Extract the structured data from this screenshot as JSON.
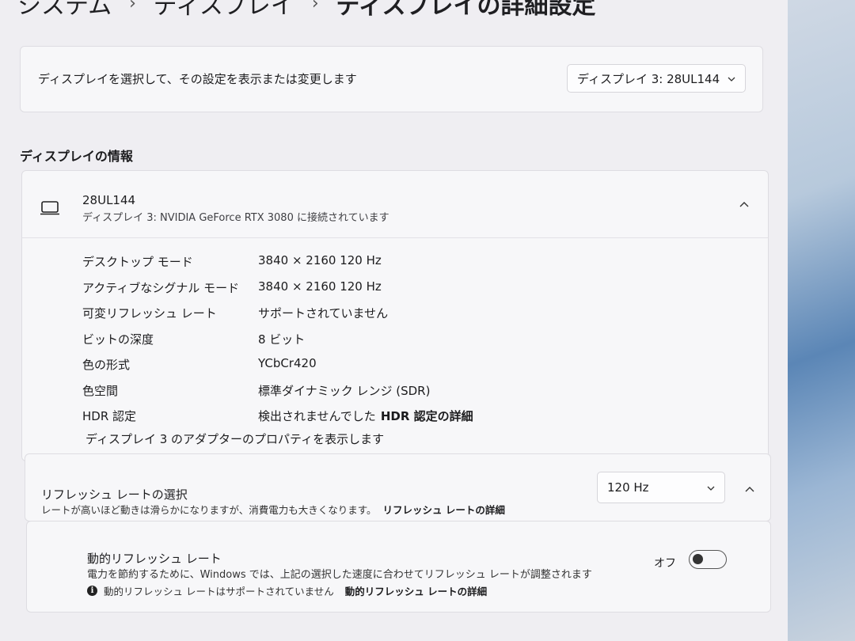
{
  "breadcrumb": {
    "items": [
      "システム",
      "ディスプレイ"
    ],
    "current": "ディスプレイの詳細設定",
    "separator": "›"
  },
  "selector": {
    "label": "ディスプレイを選択して、その設定を表示または変更します",
    "value": "ディスプレイ 3: 28UL144"
  },
  "section_title": "ディスプレイの情報",
  "monitor": {
    "name": "28UL144",
    "subtitle": "ディスプレイ 3: NVIDIA GeForce RTX 3080 に接続されています",
    "rows": [
      {
        "key": "デスクトップ モード",
        "value": "3840 × 2160 120 Hz"
      },
      {
        "key": "アクティブなシグナル モード",
        "value": "3840 × 2160 120 Hz"
      },
      {
        "key": "可変リフレッシュ レート",
        "value": "サポートされていません"
      },
      {
        "key": "ビットの深度",
        "value": "8 ビット"
      },
      {
        "key": "色の形式",
        "value": "YCbCr420"
      },
      {
        "key": "色空間",
        "value": "標準ダイナミック レンジ (SDR)"
      },
      {
        "key": "HDR 認定",
        "value": "検出されませんでした",
        "link": "HDR 認定の詳細"
      }
    ],
    "adapter_link": "ディスプレイ 3 のアダプターのプロパティを表示します"
  },
  "refresh": {
    "title": "リフレッシュ レートの選択",
    "description": "レートが高いほど動きは滑らかになりますが、消費電力も大きくなります。",
    "link": "リフレッシュ レートの詳細",
    "value": "120 Hz"
  },
  "dynamic_refresh": {
    "title": "動的リフレッシュ レート",
    "description": "電力を節約するために、Windows では、上記の選択した速度に合わせてリフレッシュ レートが調整されます",
    "note": "動的リフレッシュ レートはサポートされていません",
    "note_link": "動的リフレッシュ レートの詳細",
    "toggle_label": "オフ",
    "toggle_on": false
  },
  "icons": {
    "chevron_down": "⌄",
    "chevron_up": "^"
  }
}
